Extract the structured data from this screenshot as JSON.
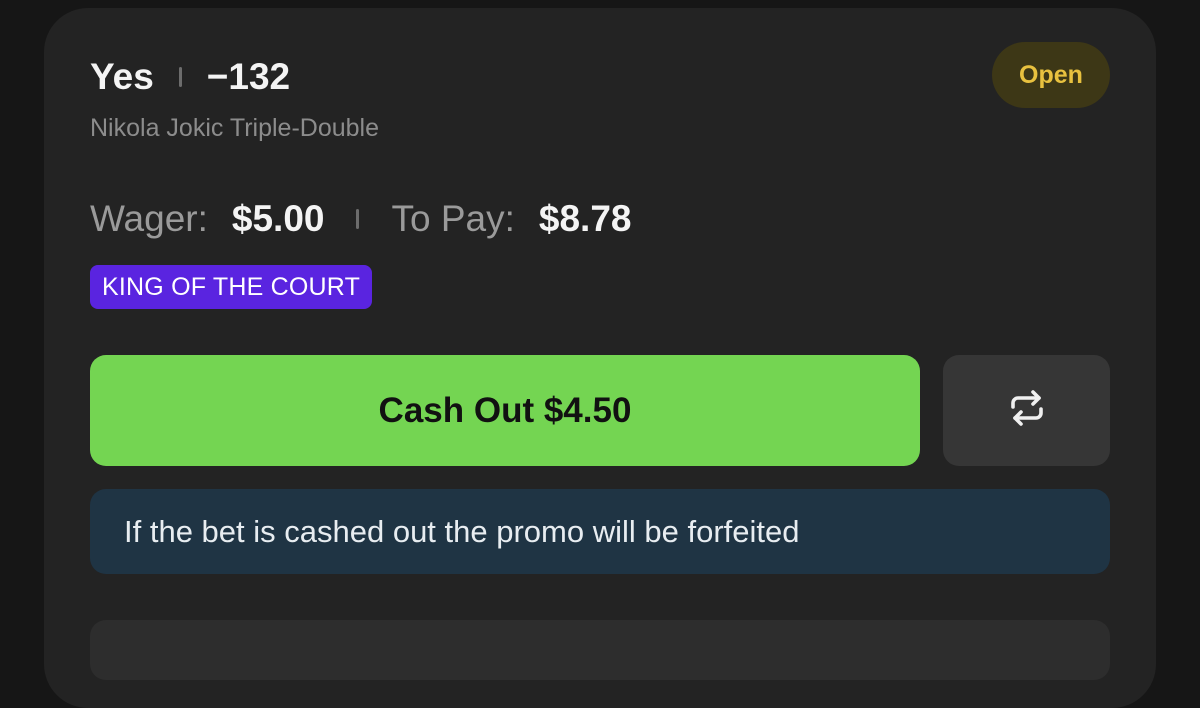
{
  "bet": {
    "selection": "Yes",
    "odds": "−132",
    "market": "Nikola Jokic Triple-Double",
    "status": "Open",
    "status_color": "#e8c13f",
    "wager_label": "Wager:",
    "wager_value": "$5.00",
    "to_pay_label": "To Pay:",
    "to_pay_value": "$8.78",
    "promo_tag": "KING OF THE COURT",
    "promo_color": "#5a24e0"
  },
  "actions": {
    "cash_out_label": "Cash Out $4.50",
    "cash_out_color": "#74d552",
    "refresh_icon": "repeat-arrows-icon"
  },
  "notice": {
    "text": "If the bet is cashed out the promo will be forfeited"
  }
}
